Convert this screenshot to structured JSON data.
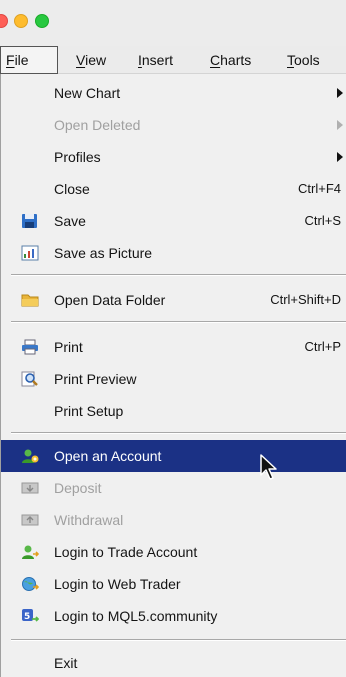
{
  "menubar": {
    "items": [
      {
        "label": "File",
        "key": "F"
      },
      {
        "label": "View",
        "key": "V"
      },
      {
        "label": "Insert",
        "key": "I"
      },
      {
        "label": "Charts",
        "key": "C"
      },
      {
        "label": "Tools",
        "key": "T"
      }
    ],
    "active": "File"
  },
  "file_menu": {
    "new_chart": "New Chart",
    "open_deleted": "Open Deleted",
    "profiles": "Profiles",
    "close": "Close",
    "close_shortcut": "Ctrl+F4",
    "save": "Save",
    "save_shortcut": "Ctrl+S",
    "save_as_picture": "Save as Picture",
    "open_data_folder": "Open Data Folder",
    "open_data_folder_shortcut": "Ctrl+Shift+D",
    "print": "Print",
    "print_shortcut": "Ctrl+P",
    "print_preview": "Print Preview",
    "print_setup": "Print Setup",
    "open_account": "Open an Account",
    "deposit": "Deposit",
    "withdrawal": "Withdrawal",
    "login_trade": "Login to Trade Account",
    "login_web": "Login to Web Trader",
    "login_mql5": "Login to MQL5.community",
    "exit": "Exit"
  },
  "icons": {
    "save": "floppy-disk-icon",
    "save_as_picture": "picture-icon",
    "open_data_folder": "folder-icon",
    "print": "printer-icon",
    "print_preview": "magnifier-icon",
    "open_account": "add-user-icon",
    "deposit": "deposit-icon",
    "withdrawal": "withdrawal-icon",
    "login_trade": "login-user-icon",
    "login_web": "web-globe-icon",
    "login_mql5": "mql5-login-icon"
  },
  "colors": {
    "highlight": "#1b3185",
    "menu_bg": "#f0f0f0",
    "disabled_text": "#a0a0a0"
  }
}
